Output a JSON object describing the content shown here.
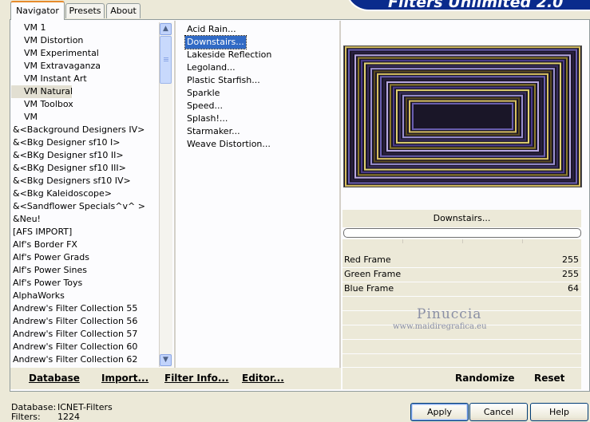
{
  "tabs": [
    {
      "label": "Navigator",
      "active": true
    },
    {
      "label": "Presets",
      "active": false
    },
    {
      "label": "About",
      "active": false
    }
  ],
  "brand_title": "Filters Unlimited 2.0",
  "categories": [
    "VM 1",
    "VM Distortion",
    "VM Experimental",
    "VM Extravaganza",
    "VM Instant Art",
    "VM Natural",
    "VM Toolbox",
    "VM",
    "&<Background Designers IV>",
    "&<Bkg Designer sf10 I>",
    "&<BKg Designer sf10 II>",
    "&<BKg Designer sf10 III>",
    "&<Bkg Designers sf10 IV>",
    "&<Bkg Kaleidoscope>",
    "&<Sandflower Specials^v^ >",
    "&Neu!",
    "[AFS IMPORT]",
    "Alf's Border FX",
    "Alf's Power Grads",
    "Alf's Power Sines",
    "Alf's Power Toys",
    "AlphaWorks",
    "Andrew's Filter Collection 55",
    "Andrew's Filter Collection 56",
    "Andrew's Filter Collection 57",
    "Andrew's Filter Collection 60",
    "Andrew's Filter Collection 62"
  ],
  "selected_category": "VM Natural",
  "filters": [
    "Acid Rain...",
    "Downstairs...",
    "Lakeside Reflection",
    "Legoland...",
    "Plastic Starfish...",
    "Sparkle",
    "Speed...",
    "Splash!...",
    "Starmaker...",
    "Weave Distortion..."
  ],
  "selected_filter": "Downstairs...",
  "preview_filter_name": "Downstairs...",
  "parameters": [
    {
      "label": "Red Frame",
      "value": "255"
    },
    {
      "label": "Green Frame",
      "value": "255"
    },
    {
      "label": "Blue Frame",
      "value": "64"
    }
  ],
  "watermark": {
    "name": "Pinuccia",
    "url": "www.maidiregrafica.eu"
  },
  "bottom_left_buttons": [
    "Database",
    "Import...",
    "Filter Info...",
    "Editor..."
  ],
  "bottom_right_buttons": [
    "Randomize",
    "Reset"
  ],
  "status": {
    "db_label": "Database:",
    "db_value": "ICNET-Filters",
    "filters_label": "Filters:",
    "filters_value": "1224"
  },
  "dialog_buttons": [
    "Apply",
    "Cancel",
    "Help"
  ],
  "colors": {
    "selection": "#316ac5",
    "brand": "#0a2b8c",
    "dialog_bg": "#ece9d8"
  }
}
